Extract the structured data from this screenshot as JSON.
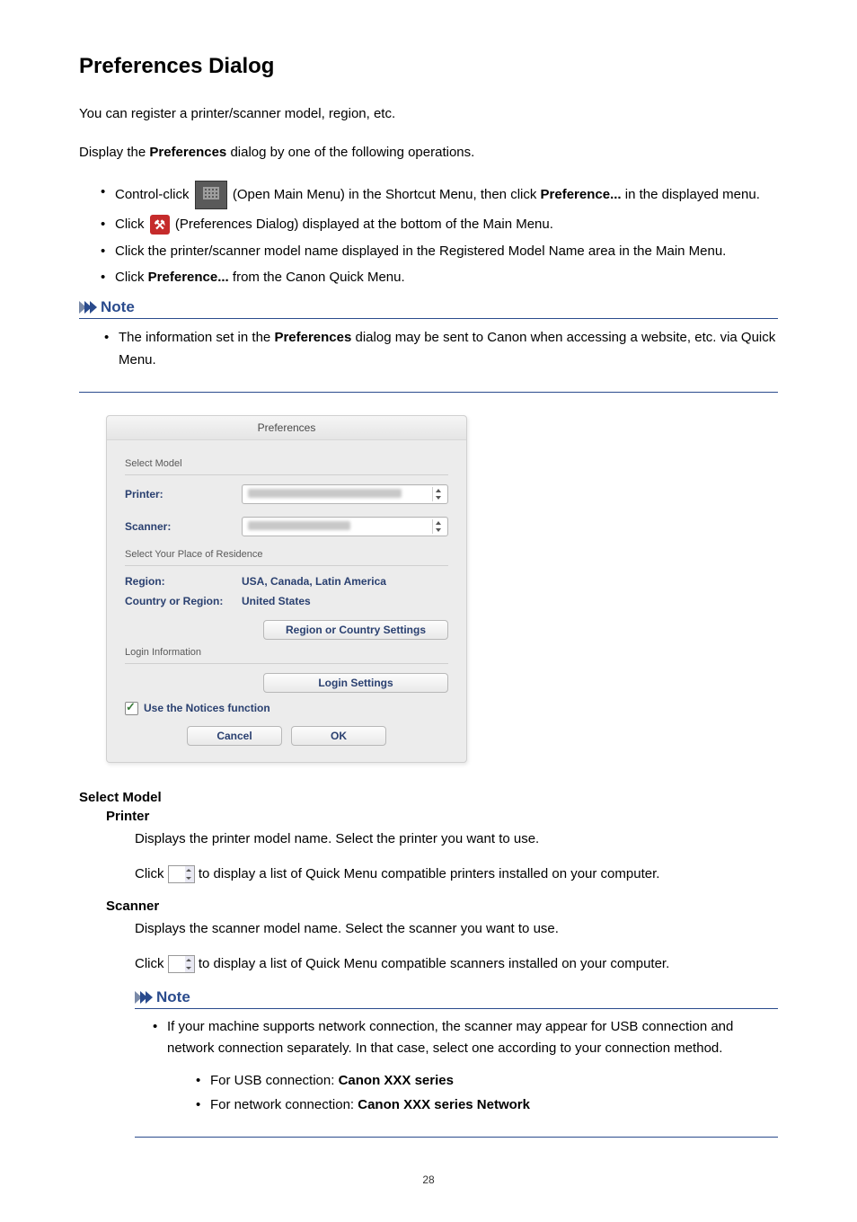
{
  "page": {
    "title": "Preferences Dialog",
    "intro": "You can register a printer/scanner model, region, etc.",
    "display_sentence_pre": "Display the ",
    "display_sentence_bold": "Preferences",
    "display_sentence_post": " dialog by one of the following operations.",
    "number": "28"
  },
  "bullets_top": {
    "b1_pre": "Control-click ",
    "b1_mid": " (Open Main Menu) in the Shortcut Menu, then click ",
    "b1_bold": "Preference...",
    "b1_post": " in the displayed menu.",
    "b2_pre": "Click ",
    "b2_post": " (Preferences Dialog) displayed at the bottom of the Main Menu.",
    "b3": "Click the printer/scanner model name displayed in the Registered Model Name area in the Main Menu.",
    "b4_pre": "Click ",
    "b4_bold": "Preference...",
    "b4_post": " from the Canon Quick Menu."
  },
  "note1": {
    "title": "Note",
    "item_pre": "The information set in the ",
    "item_bold": "Preferences",
    "item_post": " dialog may be sent to Canon when accessing a website, etc. via Quick Menu."
  },
  "dialog": {
    "title": "Preferences",
    "select_model_label": "Select Model",
    "printer_label": "Printer:",
    "scanner_label": "Scanner:",
    "residence_label": "Select Your Place of Residence",
    "region_label": "Region:",
    "region_value": "USA, Canada, Latin America",
    "country_label": "Country or Region:",
    "country_value": "United States",
    "region_settings_btn": "Region or Country Settings",
    "login_label": "Login Information",
    "login_settings_btn": "Login Settings",
    "notices_label": "Use the Notices function",
    "cancel_btn": "Cancel",
    "ok_btn": "OK"
  },
  "defs": {
    "select_model": "Select Model",
    "printer": "Printer",
    "printer_desc": "Displays the printer model name. Select the printer you want to use.",
    "printer_click_pre": "Click ",
    "printer_click_post": " to display a list of Quick Menu compatible printers installed on your computer.",
    "scanner": "Scanner",
    "scanner_desc": "Displays the scanner model name. Select the scanner you want to use.",
    "scanner_click_pre": "Click ",
    "scanner_click_post": " to display a list of Quick Menu compatible scanners installed on your computer."
  },
  "note2": {
    "title": "Note",
    "item": "If your machine supports network connection, the scanner may appear for USB connection and network connection separately. In that case, select one according to your connection method.",
    "sub1_pre": "For USB connection: ",
    "sub1_bold": "Canon XXX series",
    "sub2_pre": "For network connection: ",
    "sub2_bold": "Canon XXX series Network"
  }
}
